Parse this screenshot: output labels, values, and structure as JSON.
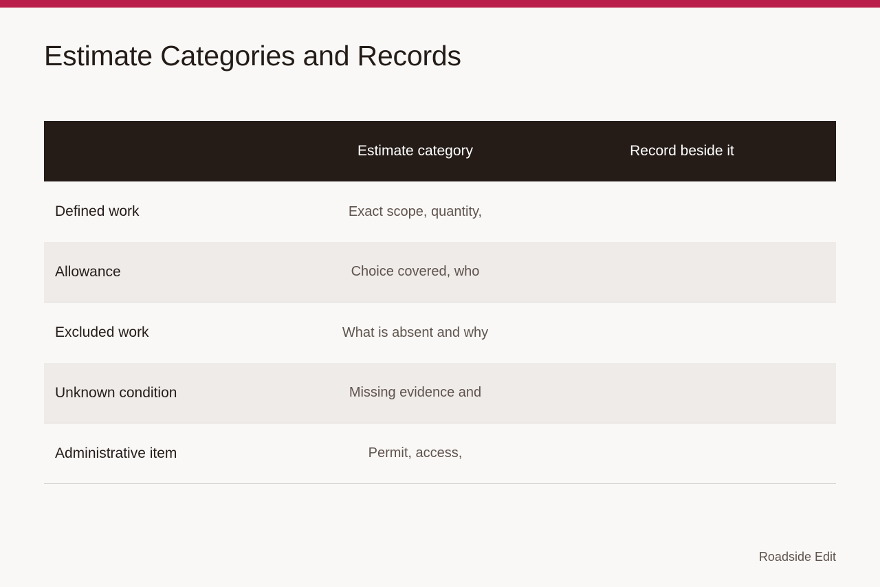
{
  "accent_color": "#ba1f4b",
  "header_color": "#251c18",
  "page_title": "Estimate Categories and Records",
  "table": {
    "columns": [
      "",
      "Estimate category",
      "Record beside it"
    ],
    "rows": [
      {
        "name": "Defined work",
        "category": "Exact scope, quantity,",
        "record": ""
      },
      {
        "name": "Allowance",
        "category": "Choice covered, who",
        "record": ""
      },
      {
        "name": "Excluded work",
        "category": "What is absent and why",
        "record": ""
      },
      {
        "name": "Unknown condition",
        "category": "Missing evidence and",
        "record": ""
      },
      {
        "name": "Administrative item",
        "category": "Permit, access,",
        "record": ""
      }
    ]
  },
  "footer": "Roadside Edit"
}
